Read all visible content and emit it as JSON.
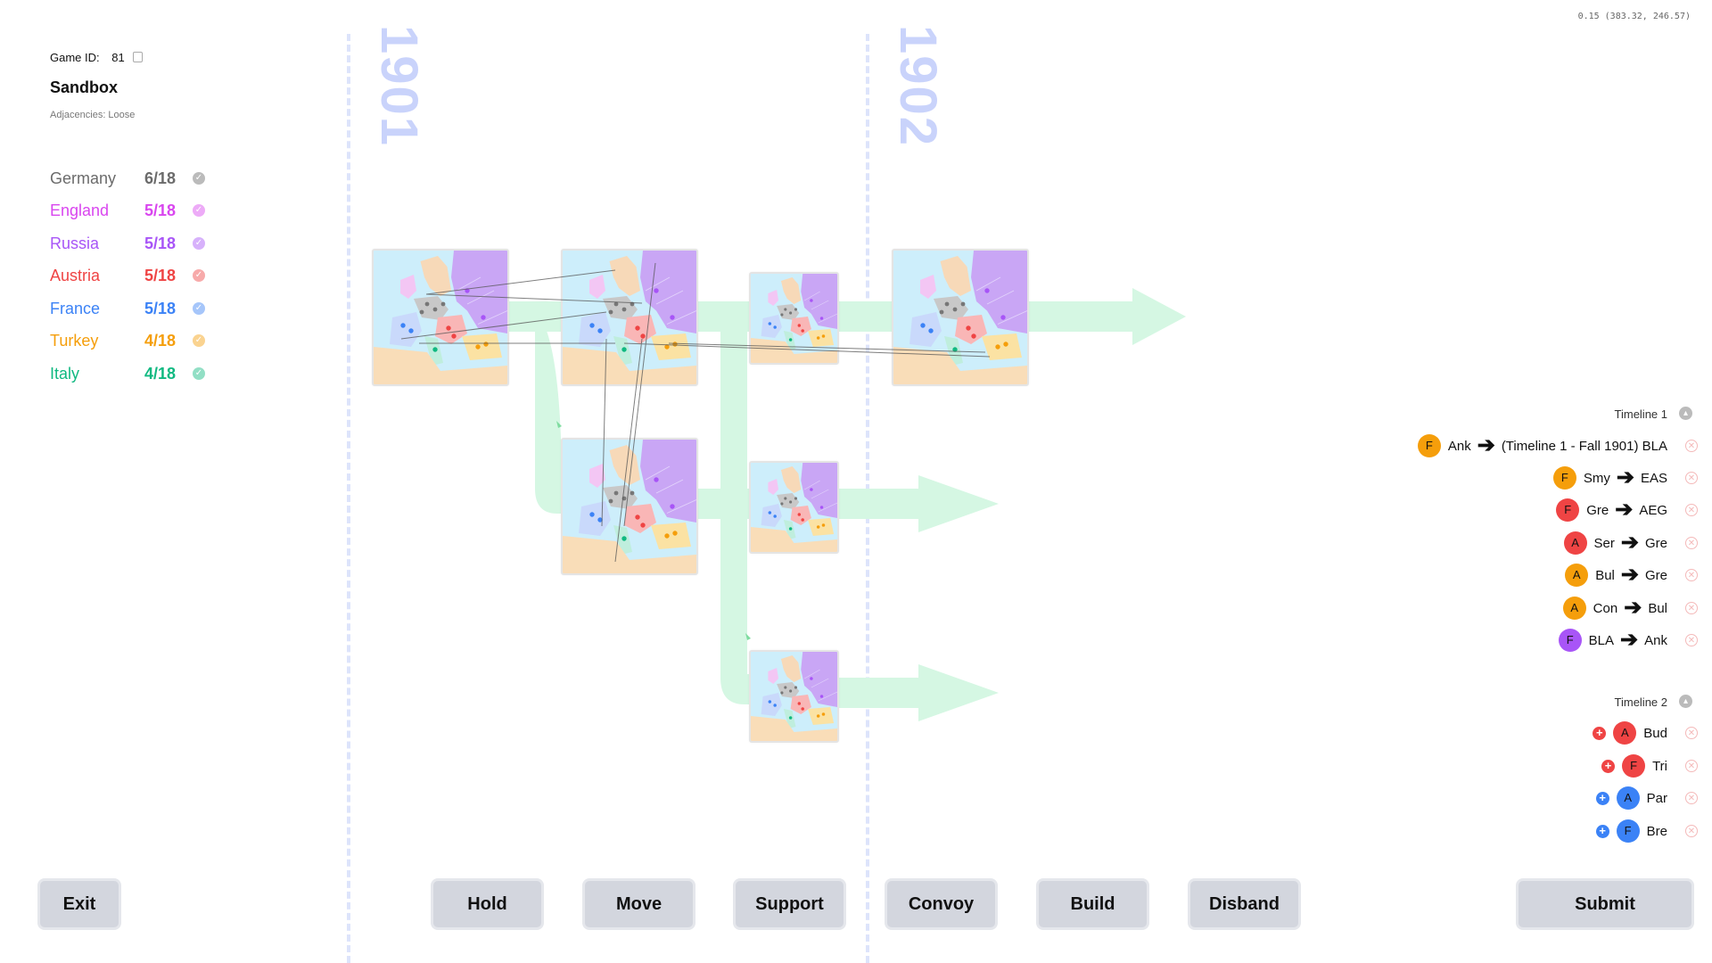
{
  "game": {
    "id_label": "Game ID:",
    "id_value": "81",
    "name": "Sandbox",
    "adjacencies": "Adjacencies: Loose"
  },
  "coords_readout": "0.15 (383.32, 246.57)",
  "years": [
    "1901",
    "1902"
  ],
  "nations": [
    {
      "name": "Germany",
      "count": "6/18",
      "color": "#6b6b6b"
    },
    {
      "name": "England",
      "count": "5/18",
      "color": "#d946ef"
    },
    {
      "name": "Russia",
      "count": "5/18",
      "color": "#a855f7"
    },
    {
      "name": "Austria",
      "count": "5/18",
      "color": "#ef4444"
    },
    {
      "name": "France",
      "count": "5/18",
      "color": "#3b82f6"
    },
    {
      "name": "Turkey",
      "count": "4/18",
      "color": "#f59e0b"
    },
    {
      "name": "Italy",
      "count": "4/18",
      "color": "#10b981"
    }
  ],
  "timeline1": {
    "label": "Timeline 1",
    "orders": [
      {
        "unit": "F",
        "color": "#f59e0b",
        "from": "Ank",
        "to": "(Timeline 1 - Fall 1901) BLA"
      },
      {
        "unit": "F",
        "color": "#f59e0b",
        "from": "Smy",
        "to": "EAS"
      },
      {
        "unit": "F",
        "color": "#ef4444",
        "from": "Gre",
        "to": "AEG"
      },
      {
        "unit": "A",
        "color": "#ef4444",
        "from": "Ser",
        "to": "Gre"
      },
      {
        "unit": "A",
        "color": "#f59e0b",
        "from": "Bul",
        "to": "Gre"
      },
      {
        "unit": "A",
        "color": "#f59e0b",
        "from": "Con",
        "to": "Bul"
      },
      {
        "unit": "F",
        "color": "#a855f7",
        "from": "BLA",
        "to": "Ank"
      }
    ]
  },
  "timeline2": {
    "label": "Timeline 2",
    "builds": [
      {
        "unit": "A",
        "color": "#ef4444",
        "where": "Bud"
      },
      {
        "unit": "F",
        "color": "#ef4444",
        "where": "Tri"
      },
      {
        "unit": "A",
        "color": "#3b82f6",
        "where": "Par"
      },
      {
        "unit": "F",
        "color": "#3b82f6",
        "where": "Bre"
      }
    ]
  },
  "buttons": {
    "exit": "Exit",
    "hold": "Hold",
    "move": "Move",
    "support": "Support",
    "convoy": "Convoy",
    "build": "Build",
    "disband": "Disband",
    "submit": "Submit"
  },
  "icons": {
    "copy": "copy-icon",
    "check": "check-circle-icon",
    "collapse": "chevron-up-icon",
    "remove": "close-circle-icon",
    "add": "plus-circle-icon",
    "arrow": "arrow-right-icon"
  }
}
